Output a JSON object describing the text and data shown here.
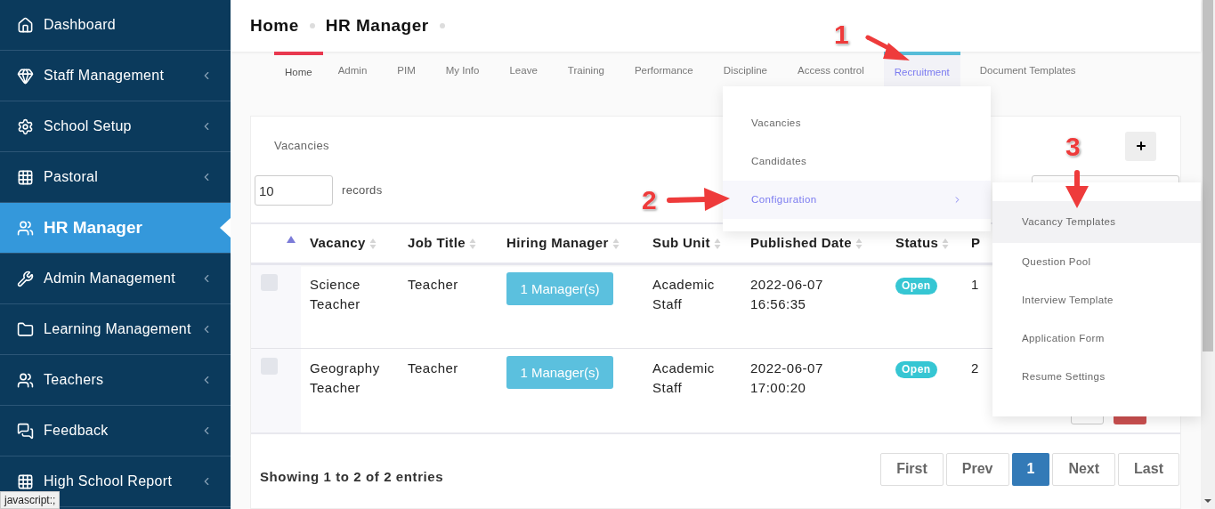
{
  "sidebar": {
    "items": [
      {
        "label": "Dashboard",
        "selected": false,
        "expandable": false
      },
      {
        "label": "Staff Management",
        "selected": false,
        "expandable": true
      },
      {
        "label": "School Setup",
        "selected": false,
        "expandable": true
      },
      {
        "label": "Pastoral",
        "selected": false,
        "expandable": true
      },
      {
        "label": "HR Manager",
        "selected": true,
        "expandable": false
      },
      {
        "label": "Admin Management",
        "selected": false,
        "expandable": true
      },
      {
        "label": "Learning Management",
        "selected": false,
        "expandable": true
      },
      {
        "label": "Teachers",
        "selected": false,
        "expandable": true
      },
      {
        "label": "Feedback",
        "selected": false,
        "expandable": true
      },
      {
        "label": "High School Report",
        "selected": false,
        "expandable": true
      }
    ]
  },
  "breadcrumbs": [
    "Home",
    "HR Manager"
  ],
  "tabs": [
    {
      "label": "Home",
      "selected": true,
      "expanded": false
    },
    {
      "label": "Admin",
      "selected": false,
      "expanded": false
    },
    {
      "label": "PIM",
      "selected": false,
      "expanded": false
    },
    {
      "label": "My Info",
      "selected": false,
      "expanded": false
    },
    {
      "label": "Leave",
      "selected": false,
      "expanded": false
    },
    {
      "label": "Training",
      "selected": false,
      "expanded": false
    },
    {
      "label": "Performance",
      "selected": false,
      "expanded": false
    },
    {
      "label": "Discipline",
      "selected": false,
      "expanded": false
    },
    {
      "label": "Access control",
      "selected": false,
      "expanded": false
    },
    {
      "label": "Recruitment",
      "selected": false,
      "expanded": true
    },
    {
      "label": "Document Templates",
      "selected": false,
      "expanded": false
    }
  ],
  "recruitment_menu": [
    {
      "label": "Vacancies",
      "expanded": false
    },
    {
      "label": "Candidates",
      "expanded": false
    },
    {
      "label": "Configuration",
      "expanded": true
    }
  ],
  "configuration_menu": [
    {
      "label": "Vacancy Templates",
      "selected": true
    },
    {
      "label": "Question Pool",
      "selected": false
    },
    {
      "label": "Interview Template",
      "selected": false
    },
    {
      "label": "Application Form",
      "selected": false
    },
    {
      "label": "Resume Settings",
      "selected": false
    }
  ],
  "card": {
    "title": "Vacancies",
    "page_size": "10",
    "page_size_label": "records"
  },
  "table": {
    "columns": [
      "Vacancy",
      "Job Title",
      "Hiring Manager",
      "Sub Unit",
      "Published Date",
      "Status",
      "P"
    ],
    "rows": [
      {
        "checked": false,
        "vacancy": "Science Teacher",
        "job_title": "Teacher",
        "hiring_manager": "1 Manager(s)",
        "sub_unit": "Academic Staff",
        "published_date": "2022-06-07 16:56:35",
        "status": "Open",
        "column_7": "1"
      },
      {
        "checked": false,
        "vacancy": "Geography Teacher",
        "job_title": "Teacher",
        "hiring_manager": "1 Manager(s)",
        "sub_unit": "Academic Staff",
        "published_date": "2022-06-07 17:00:20",
        "status": "Open",
        "column_7": "2"
      }
    ]
  },
  "summary": "Showing 1 to 2 of 2 entries",
  "pagination": [
    {
      "label": "First",
      "selected": false
    },
    {
      "label": "Prev",
      "selected": false
    },
    {
      "label": "1",
      "selected": true
    },
    {
      "label": "Next",
      "selected": false
    },
    {
      "label": "Last",
      "selected": false
    }
  ],
  "annotations": [
    "1",
    "2",
    "3"
  ],
  "status_bar": "javascript:;"
}
